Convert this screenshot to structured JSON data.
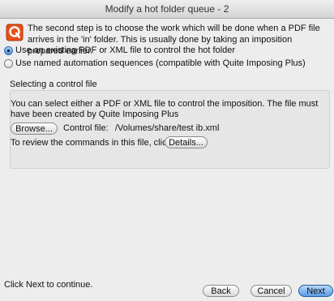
{
  "window": {
    "title": "Modify a hot folder queue - 2"
  },
  "intro": {
    "icon": "app-logo-icon",
    "text": "The second step is to choose the work which will be done when a PDF file arrives in the 'in' folder. This is usually done by taking an imposition prepared earlier."
  },
  "options": [
    {
      "label": "Use an existing PDF or XML file to control the hot folder",
      "selected": true
    },
    {
      "label": "Use named automation sequences (compatible with Quite Imposing Plus)",
      "selected": false
    }
  ],
  "control_file_group": {
    "title": "Selecting a control file",
    "description": "You can select either a PDF or XML file to control the imposition. The file must have been created by Quite Imposing Plus",
    "browse_label": "Browse...",
    "control_file_label": "Control file:",
    "control_file_value": "/Volumes/share/test ib.xml",
    "review_text": "To review the commands in this file, click",
    "details_label": "Details..."
  },
  "footer": {
    "instruction": "Click Next to continue.",
    "back_label": "Back",
    "cancel_label": "Cancel",
    "next_label": "Next"
  },
  "colors": {
    "accent": "#5a9be3",
    "logo": "#e8501a"
  }
}
